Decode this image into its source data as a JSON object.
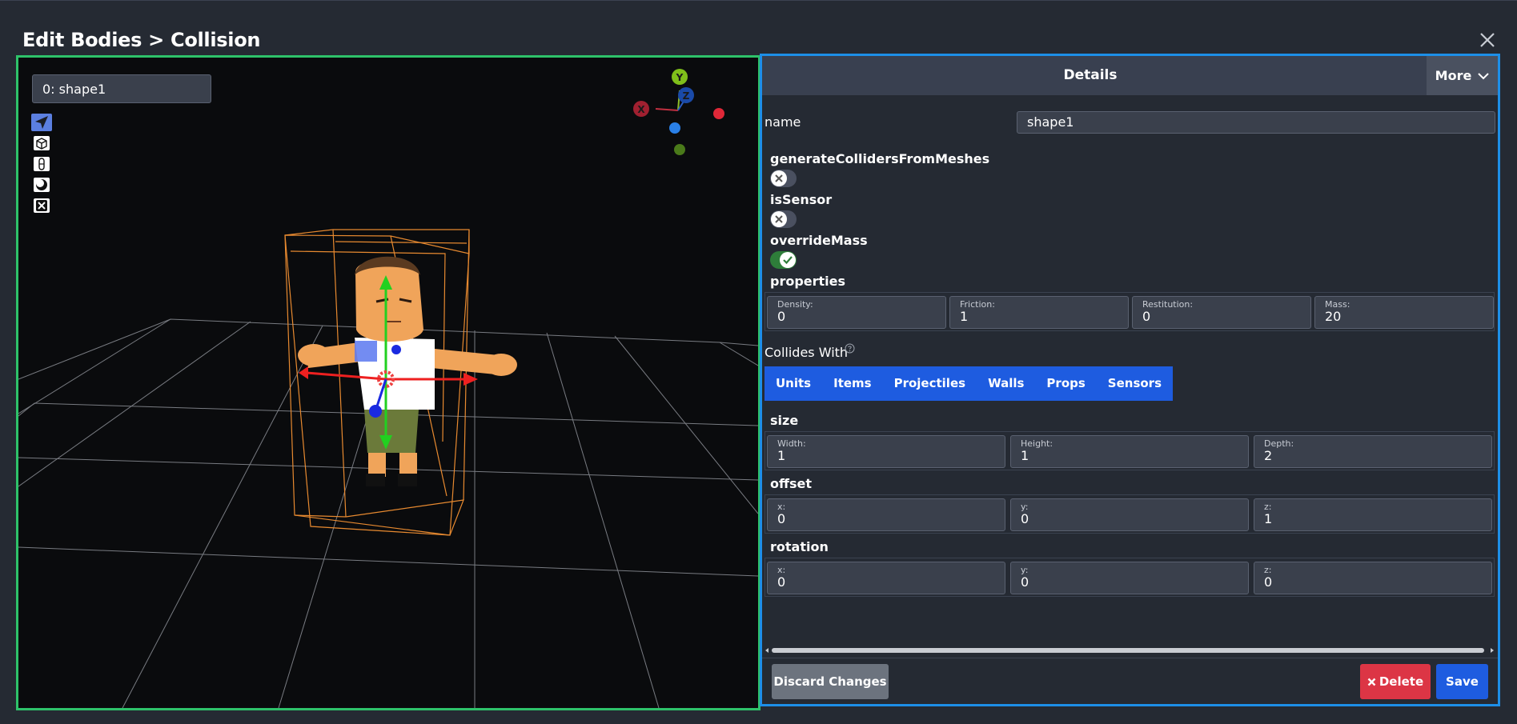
{
  "title": "Edit Bodies > Collision",
  "icons": {
    "close": "close-icon",
    "chevron": "chevron-down-icon",
    "help": "question-circle-icon",
    "delete": "x-icon"
  },
  "viewport": {
    "shape_select": "0: shape1",
    "tools": [
      "select-arrow-icon",
      "cube-icon",
      "capsule-icon",
      "sphere-icon",
      "remove-box-icon"
    ],
    "gizmo_labels": {
      "y": "Y",
      "x": "X",
      "z": "Z"
    }
  },
  "details": {
    "title": "Details",
    "more_label": "More",
    "name_label": "name",
    "name_value": "shape1",
    "toggles": [
      {
        "label": "generateCollidersFromMeshes",
        "on": false
      },
      {
        "label": "isSensor",
        "on": false
      },
      {
        "label": "overrideMass",
        "on": true
      }
    ],
    "properties": {
      "label": "properties",
      "fields": [
        {
          "label": "Density:",
          "value": "0"
        },
        {
          "label": "Friction:",
          "value": "1"
        },
        {
          "label": "Restitution:",
          "value": "0"
        },
        {
          "label": "Mass:",
          "value": "20"
        }
      ]
    },
    "collides_with": {
      "label": "Collides With",
      "options": [
        "Units",
        "Items",
        "Projectiles",
        "Walls",
        "Props",
        "Sensors"
      ]
    },
    "size": {
      "label": "size",
      "fields": [
        {
          "label": "Width:",
          "value": "1"
        },
        {
          "label": "Height:",
          "value": "1"
        },
        {
          "label": "Depth:",
          "value": "2"
        }
      ]
    },
    "offset": {
      "label": "offset",
      "fields": [
        {
          "label": "x:",
          "value": "0"
        },
        {
          "label": "y:",
          "value": "0"
        },
        {
          "label": "z:",
          "value": "1"
        }
      ]
    },
    "rotation": {
      "label": "rotation",
      "fields": [
        {
          "label": "x:",
          "value": "0"
        },
        {
          "label": "y:",
          "value": "0"
        },
        {
          "label": "z:",
          "value": "0"
        }
      ]
    }
  },
  "footer": {
    "discard_label": "Discard Changes",
    "delete_label": "Delete",
    "save_label": "Save"
  },
  "colors": {
    "viewport_border": "#2ec26a",
    "panel_border": "#1d8fe8",
    "primary": "#1e5ce0",
    "danger": "#dc3545",
    "secondary": "#6c737e"
  }
}
